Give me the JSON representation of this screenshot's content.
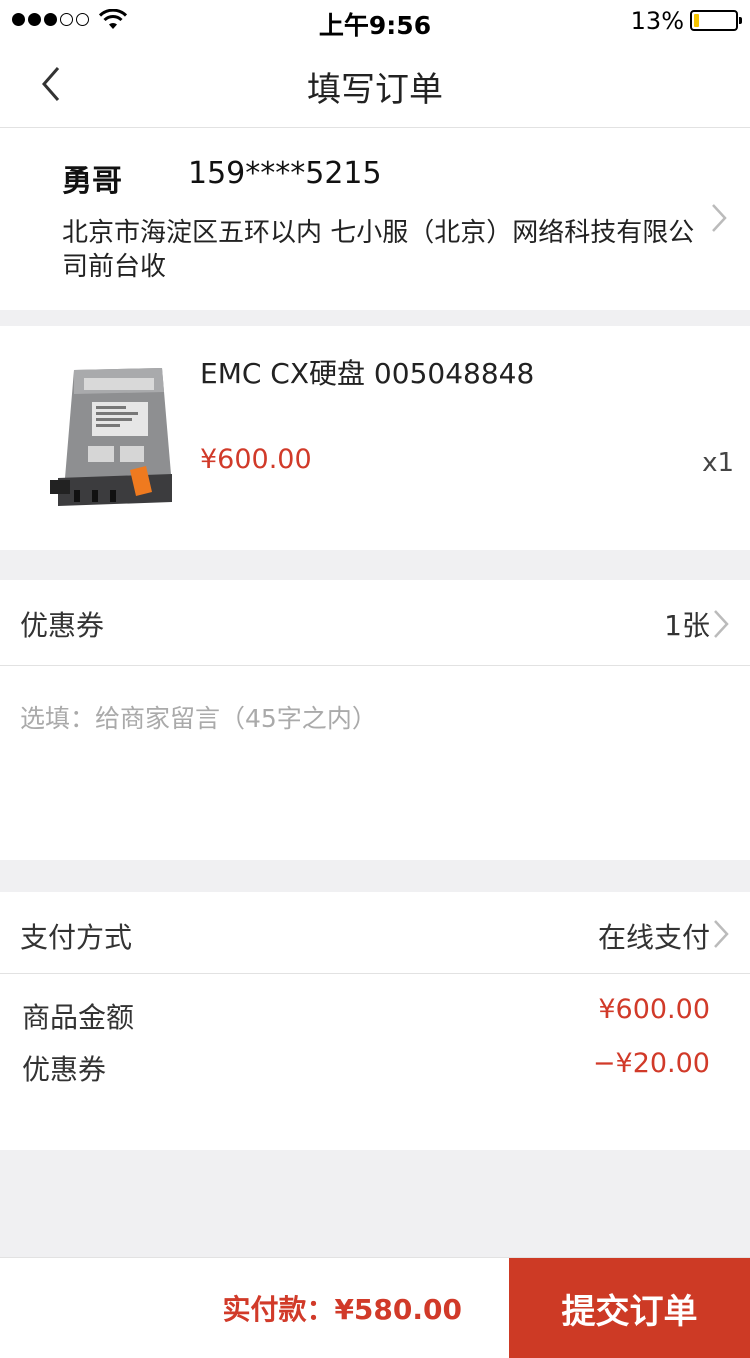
{
  "status_bar": {
    "time": "上午9:56",
    "battery_percent": "13%",
    "battery_level": 0.13,
    "signal_bars_filled": 3,
    "signal_bars_total": 5
  },
  "nav": {
    "title": "填写订单",
    "back_icon": "chevron-left-icon"
  },
  "address": {
    "name": "勇哥",
    "phone": "159****5215",
    "detail": "北京市海淀区五环以内 七小服（北京）网络科技有限公司前台收"
  },
  "product": {
    "name": "EMC CX硬盘  005048848",
    "price": "¥600.00",
    "quantity": "x1",
    "image_icon": "server-drive-module"
  },
  "coupon": {
    "label": "优惠券",
    "value": "1张"
  },
  "message": {
    "placeholder": "选填：给商家留言（45字之内）"
  },
  "payment": {
    "label": "支付方式",
    "value": "在线支付"
  },
  "summary": {
    "goods_label": "商品金额",
    "goods_value": "¥600.00",
    "coupon_label": "优惠券",
    "coupon_value": "−¥20.00"
  },
  "bottom": {
    "total": "实付款：¥580.00",
    "submit_label": "提交订单"
  },
  "colors": {
    "accent": "#d13a29",
    "submit_bg": "#cd3a25",
    "page_bg": "#f0f0f2"
  }
}
